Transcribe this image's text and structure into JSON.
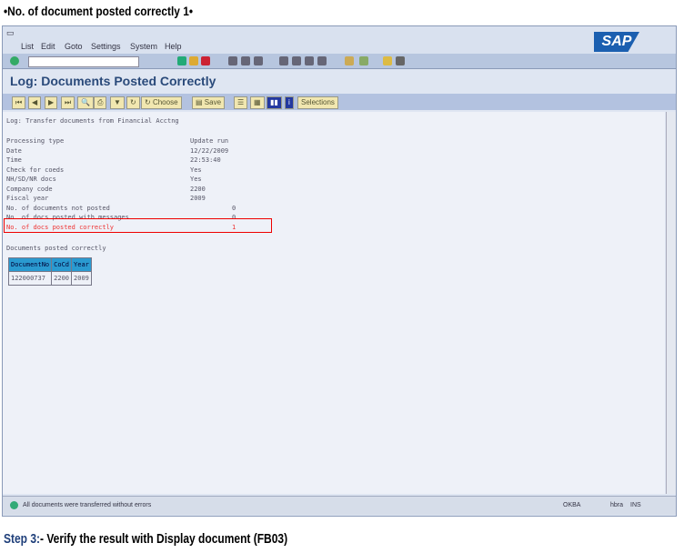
{
  "heading": "•No. of document posted correctly 1•",
  "sap": {
    "menu": [
      "List",
      "Edit",
      "Goto",
      "Settings",
      "System",
      "Help"
    ],
    "logo": "SAP",
    "title": "Log: Documents Posted Correctly",
    "app_toolbar": {
      "choose": "Choose",
      "save": "Save",
      "selections": "Selections"
    },
    "log_header": "Log: Transfer documents from Financial Acctng",
    "fields": [
      {
        "label": "Processing type",
        "value": "Update run"
      },
      {
        "label": "Date",
        "value": "12/22/2009"
      },
      {
        "label": "Time",
        "value": "22:53:40"
      },
      {
        "label": "Check for coeds",
        "value": "Yes"
      },
      {
        "label": "NH/SD/NR docs",
        "value": "Yes"
      },
      {
        "label": "Company code",
        "value": "2200"
      },
      {
        "label": "Fiscal year",
        "value": "2009"
      }
    ],
    "counts": [
      {
        "label": "No. of documents not posted",
        "value": "0"
      },
      {
        "label": "No. of docs posted with messages",
        "value": "0"
      },
      {
        "label": "No. of docs posted correctly",
        "value": "1"
      }
    ],
    "table_title": "Documents posted correctly",
    "table": {
      "headers": [
        "DocumentNo",
        "CoCd",
        "Year"
      ],
      "rows": [
        [
          "122000737",
          "2200",
          "2009"
        ]
      ]
    },
    "status": {
      "message": "All documents were transferred without errors",
      "system": "OKBA",
      "client": "hbra",
      "mode": "INS"
    }
  },
  "step": {
    "prefix": "Step 3:",
    "text": "- Verify the result with Display document (FB03)"
  }
}
